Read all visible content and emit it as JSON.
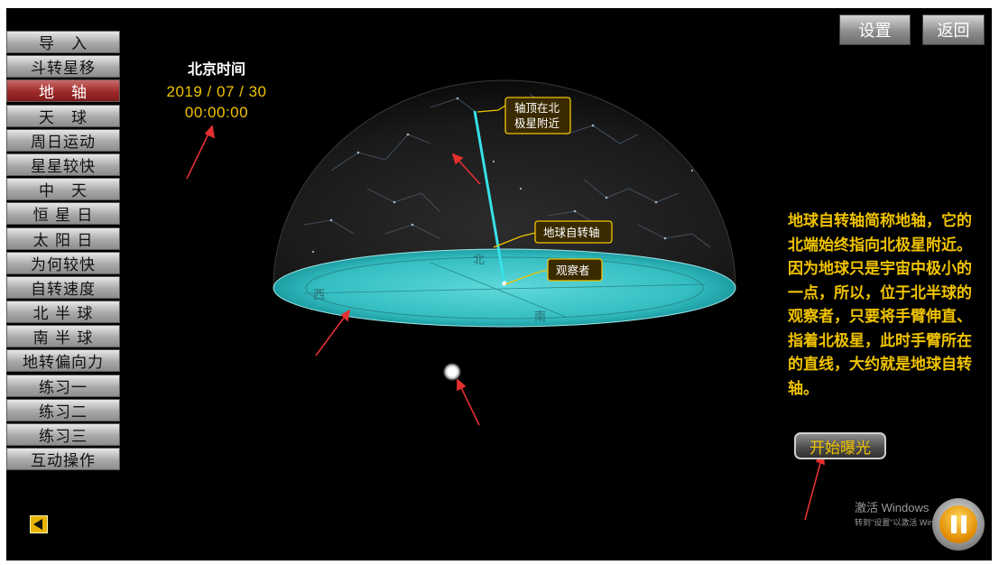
{
  "sidebar": {
    "items": [
      {
        "label": "导　入"
      },
      {
        "label": "斗转星移"
      },
      {
        "label": "地　轴"
      },
      {
        "label": "天　球"
      },
      {
        "label": "周日运动"
      },
      {
        "label": "星星较快"
      },
      {
        "label": "中　天"
      },
      {
        "label": "恒 星 日"
      },
      {
        "label": "太 阳 日"
      },
      {
        "label": "为何较快"
      },
      {
        "label": "自转速度"
      },
      {
        "label": "北 半 球"
      },
      {
        "label": "南 半 球"
      },
      {
        "label": "地转偏向力"
      },
      {
        "label": "练习一"
      },
      {
        "label": "练习二"
      },
      {
        "label": "练习三"
      },
      {
        "label": "互动操作"
      }
    ],
    "active_index": 2
  },
  "clock": {
    "label": "北京时间",
    "date": "2019 / 07 / 30",
    "time": "00:00:00"
  },
  "header": {
    "settings_label": "设置",
    "return_label": "返回"
  },
  "scene": {
    "callouts": {
      "axis_top_line1": "轴顶在北",
      "axis_top_line2": "极星附近",
      "earth_axis": "地球自转轴",
      "observer": "观察者"
    },
    "horizon_labels": {
      "north": "北",
      "south": "南",
      "west": "西"
    }
  },
  "description": {
    "text": "地球自转轴简称地轴，它的北端始终指向北极星附近。因为地球只是宇宙中极小的一点，所以，位于北半球的观察者，只要将手臂伸直、指着北极星，此时手臂所在的直线，大约就是地球自转轴。"
  },
  "actions": {
    "expose_label": "开始曝光"
  },
  "watermark": {
    "line1": "激活 Windows",
    "line2": "转到\"设置\"以激活 Windows。"
  },
  "colors": {
    "accent": "#f0c300",
    "active_menu": "#9e2a2a",
    "horizon": "#38c4c8",
    "axis": "#36e0e8"
  },
  "icons": {
    "back": "back-arrow-icon",
    "pause": "pause-icon"
  }
}
